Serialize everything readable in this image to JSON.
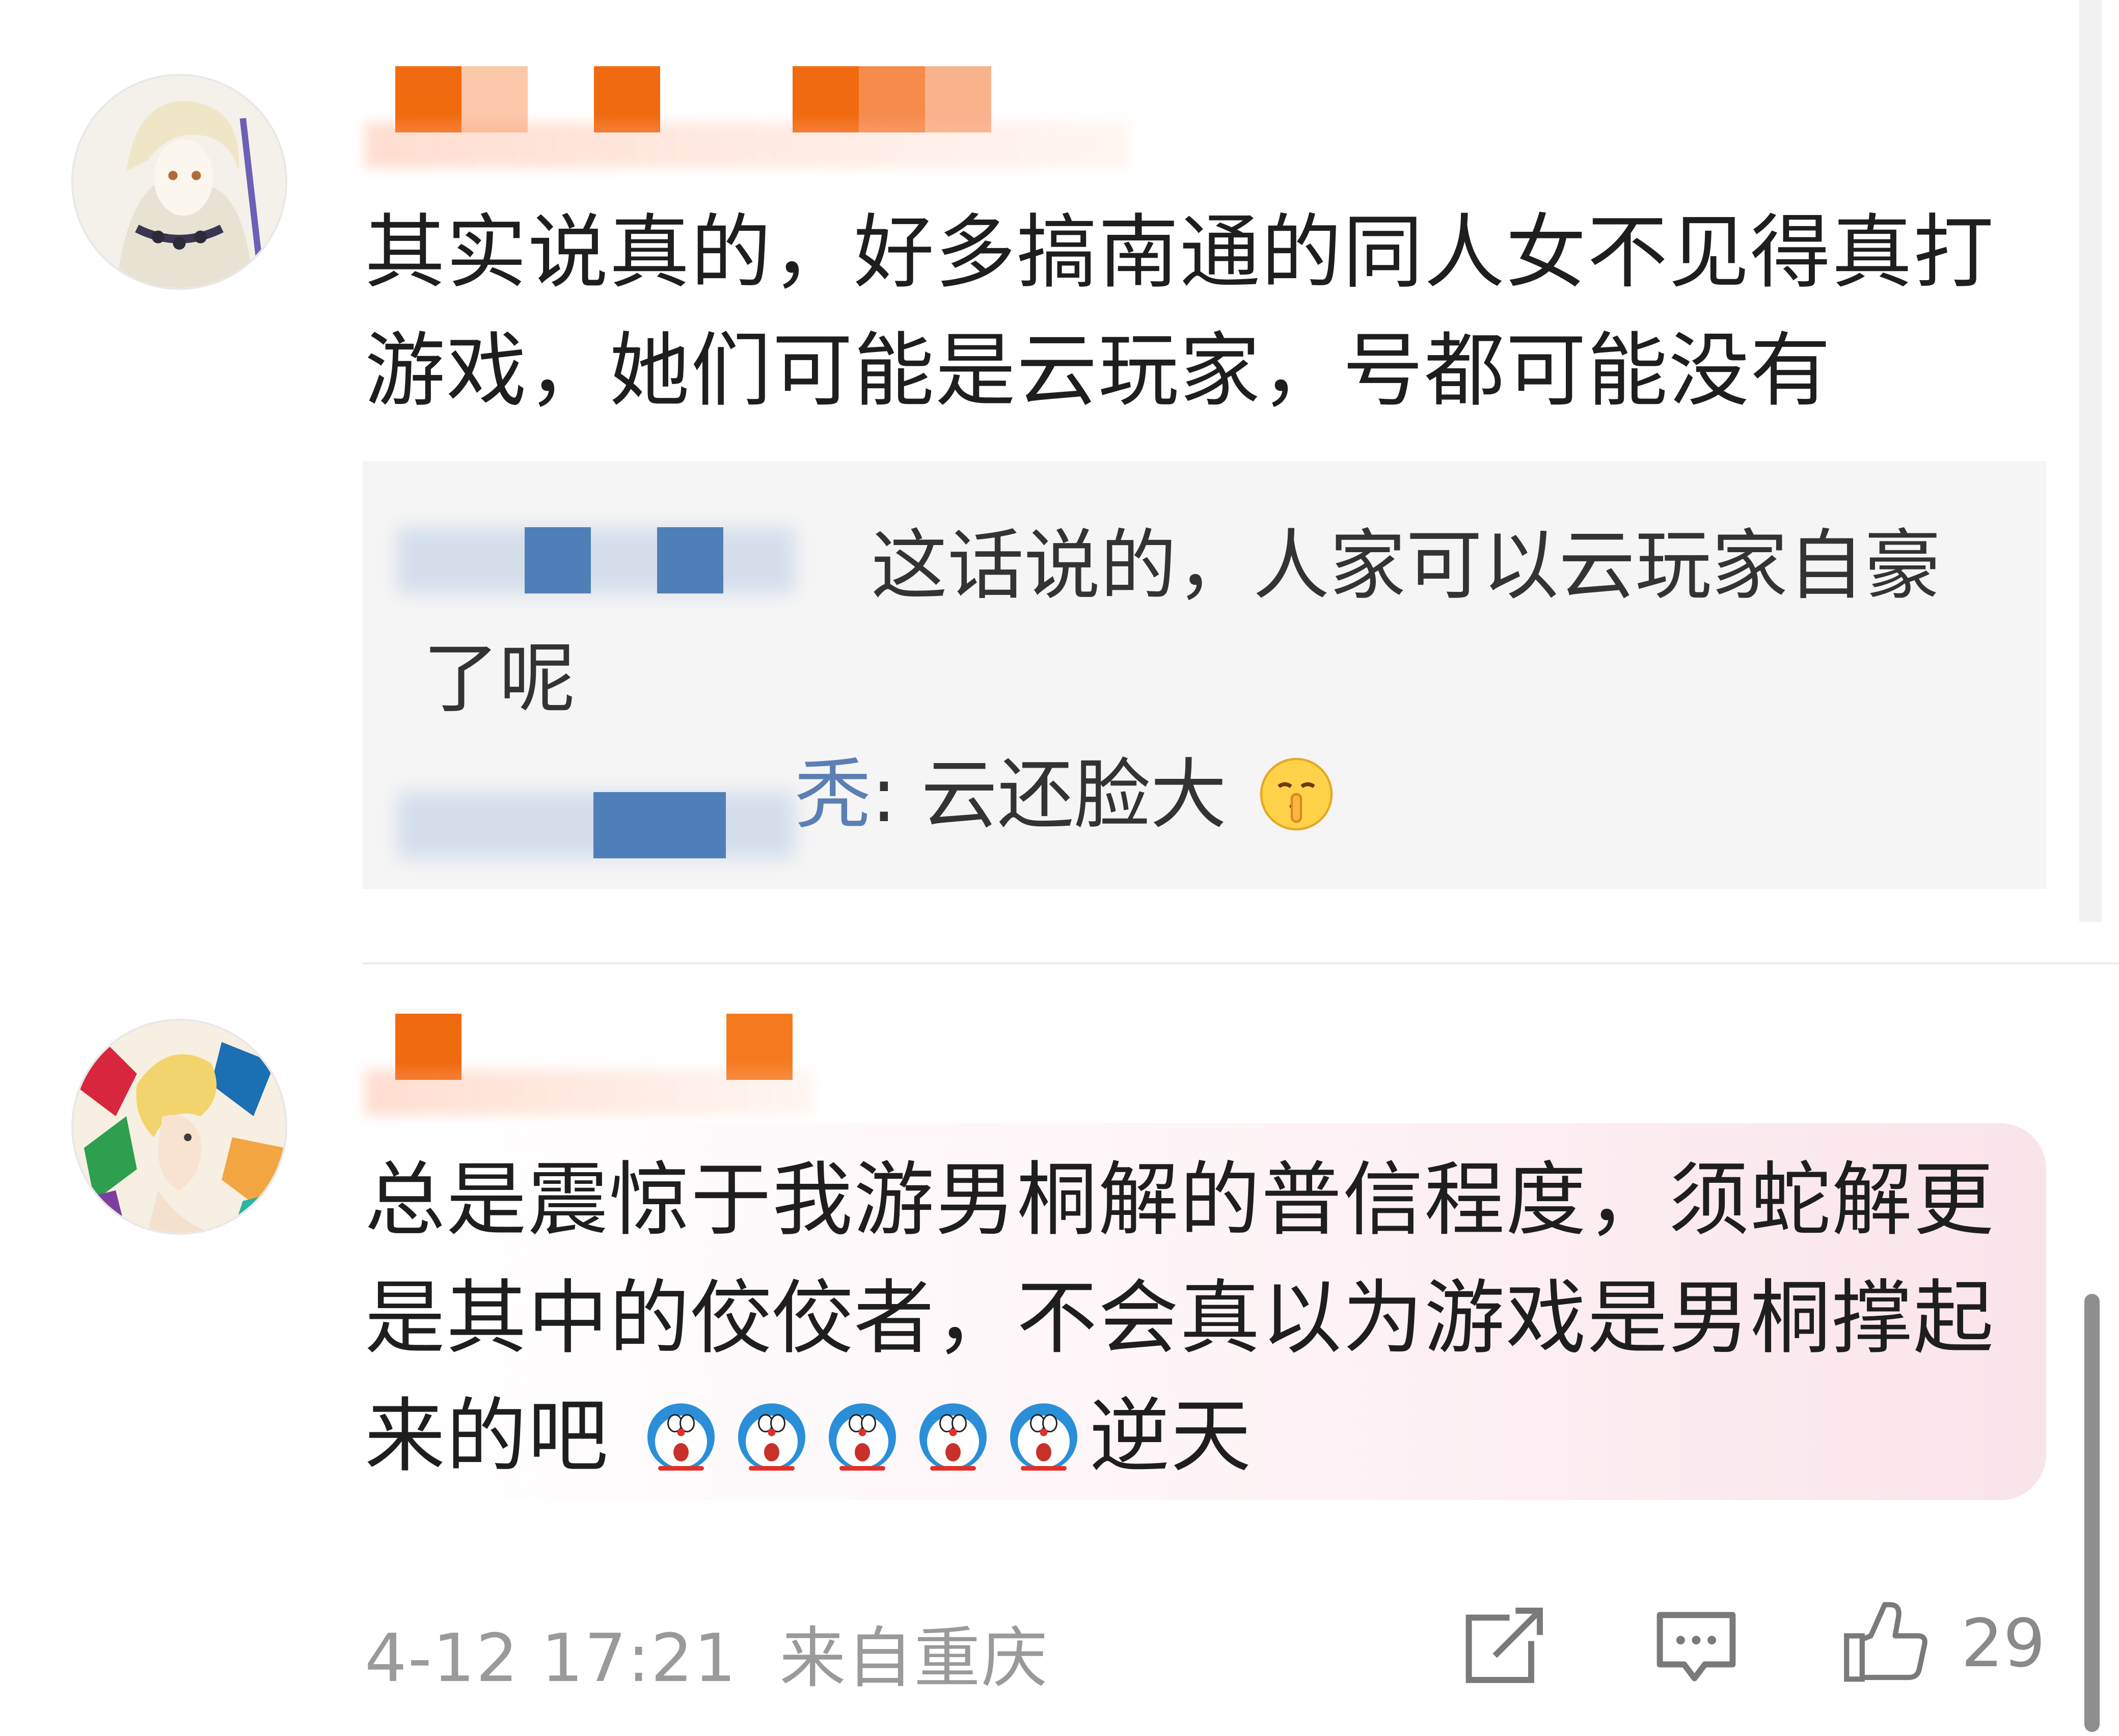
{
  "comments": [
    {
      "text": "其实说真的，好多搞南通的同人女不见得真打游戏，她们可能是云玩家，号都可能没有",
      "reply": {
        "first_text": "这话说的，人家可以云玩家自豪了呢",
        "second_author_tail": "秃",
        "second_text": ": 云还脸大"
      }
    },
    {
      "text_main": "总是震惊于我游男桐解的普信程度，须蛇解更是其中的佼佼者，不会真以为游戏是男桐撑起来的吧",
      "text_tail": "逆天",
      "date": "4-12 17:21",
      "location": "来自重庆",
      "like_count": "29"
    }
  ],
  "colors": {
    "username_orange": "#f06a0f",
    "reply_author_blue": "#5b7fb4",
    "reply_bg": "#f5f5f5",
    "meta_gray": "#9a9a9a"
  },
  "icons": [
    "repost-icon",
    "comment-icon",
    "like-icon",
    "doraemon-emoji",
    "shush-emoji"
  ]
}
